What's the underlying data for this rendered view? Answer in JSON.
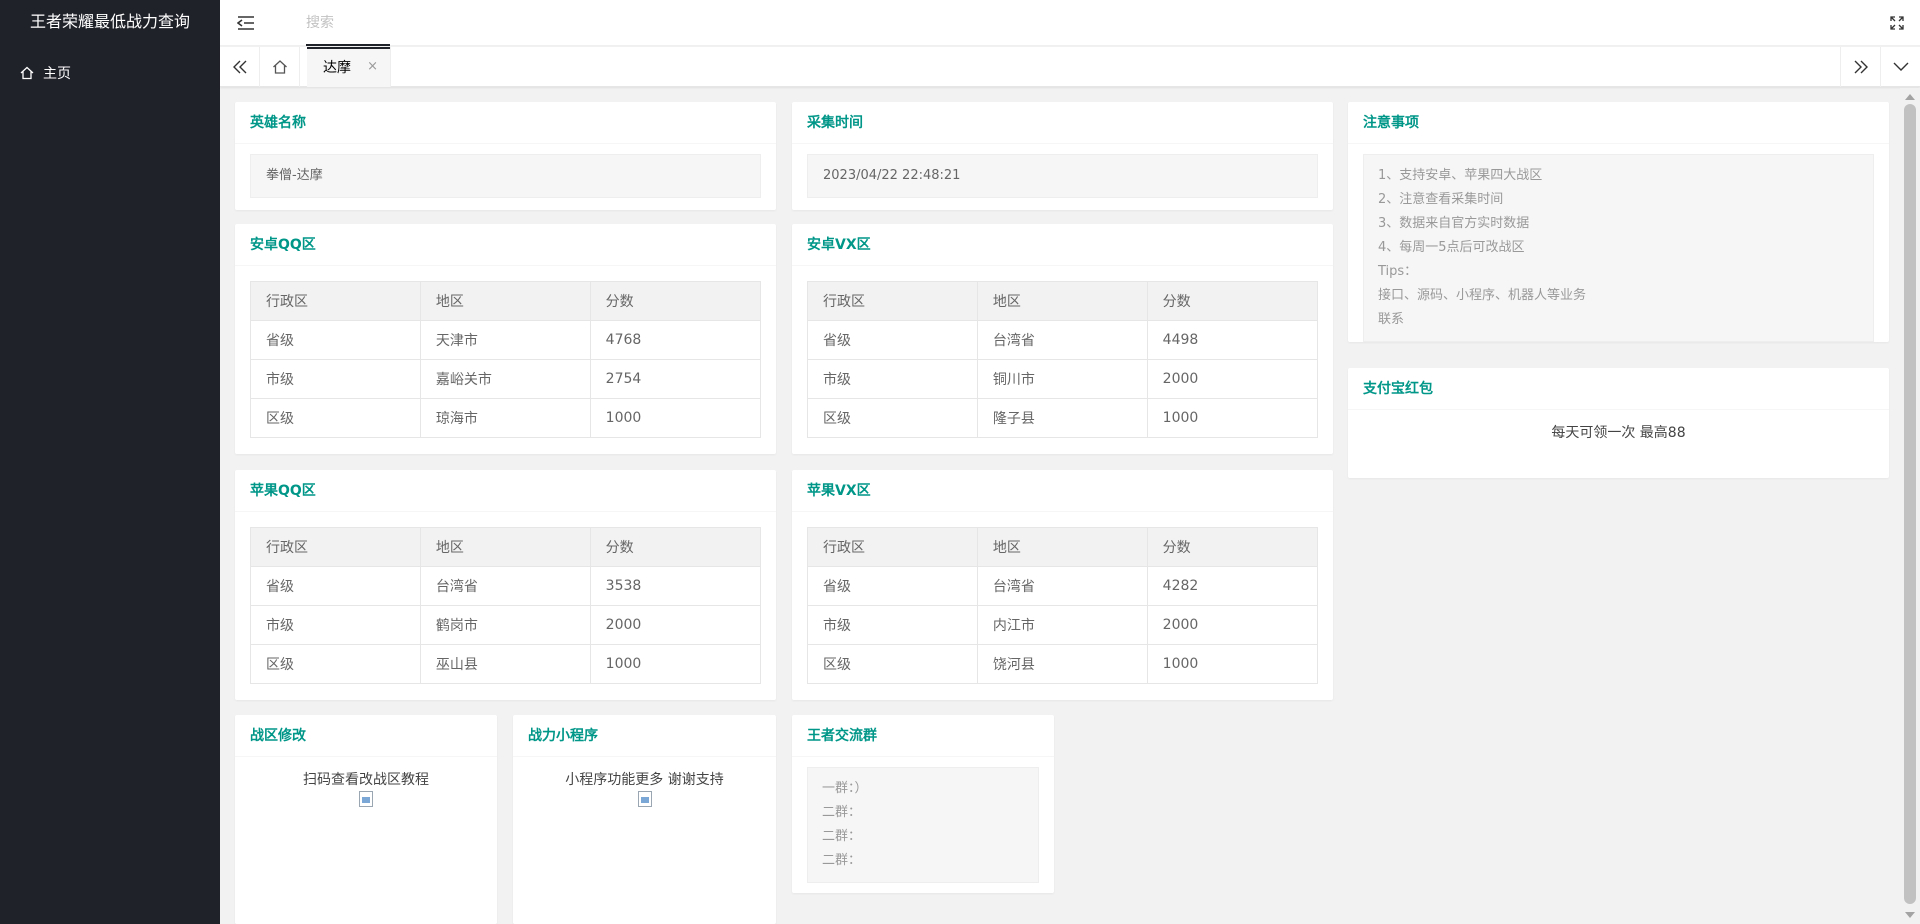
{
  "app": {
    "title": "王者荣耀最低战力查询"
  },
  "sidebar": {
    "items": [
      {
        "label": "主页",
        "icon": "home-icon"
      }
    ]
  },
  "header": {
    "search_placeholder": "搜索"
  },
  "tabs": {
    "active_label": "达摩",
    "close_glyph": "×"
  },
  "hero": {
    "title": "英雄名称",
    "value": "拳僧-达摩"
  },
  "collect": {
    "title": "采集时间",
    "value": "2023/04/22 22:48:21"
  },
  "notes": {
    "title": "注意事项",
    "lines": [
      "1、支持安卓、苹果四大战区",
      "2、注意查看采集时间",
      "3、数据来自官方实时数据",
      "4、每周一5点后可改战区",
      "Tips：",
      "接口、源码、小程序、机器人等业务",
      "联系"
    ]
  },
  "alipay": {
    "title": "支付宝红包",
    "text": "每天可领一次 最高88"
  },
  "tables": [
    {
      "title": "安卓QQ区",
      "headers": [
        "行政区",
        "地区",
        "分数"
      ],
      "rows": [
        [
          "省级",
          "天津市",
          "4768"
        ],
        [
          "市级",
          "嘉峪关市",
          "2754"
        ],
        [
          "区级",
          "琼海市",
          "1000"
        ]
      ]
    },
    {
      "title": "安卓VX区",
      "headers": [
        "行政区",
        "地区",
        "分数"
      ],
      "rows": [
        [
          "省级",
          "台湾省",
          "4498"
        ],
        [
          "市级",
          "铜川市",
          "2000"
        ],
        [
          "区级",
          "隆子县",
          "1000"
        ]
      ]
    },
    {
      "title": "苹果QQ区",
      "headers": [
        "行政区",
        "地区",
        "分数"
      ],
      "rows": [
        [
          "省级",
          "台湾省",
          "3538"
        ],
        [
          "市级",
          "鹤岗市",
          "2000"
        ],
        [
          "区级",
          "巫山县",
          "1000"
        ]
      ]
    },
    {
      "title": "苹果VX区",
      "headers": [
        "行政区",
        "地区",
        "分数"
      ],
      "rows": [
        [
          "省级",
          "台湾省",
          "4282"
        ],
        [
          "市级",
          "内江市",
          "2000"
        ],
        [
          "区级",
          "饶河县",
          "1000"
        ]
      ]
    }
  ],
  "zone_change": {
    "title": "战区修改",
    "text": "扫码查看改战区教程"
  },
  "mini_program": {
    "title": "战力小程序",
    "text": "小程序功能更多 谢谢支持"
  },
  "groups": {
    "title": "王者交流群",
    "lines": [
      "一群：）",
      "二群：",
      "二群：",
      "二群："
    ]
  }
}
